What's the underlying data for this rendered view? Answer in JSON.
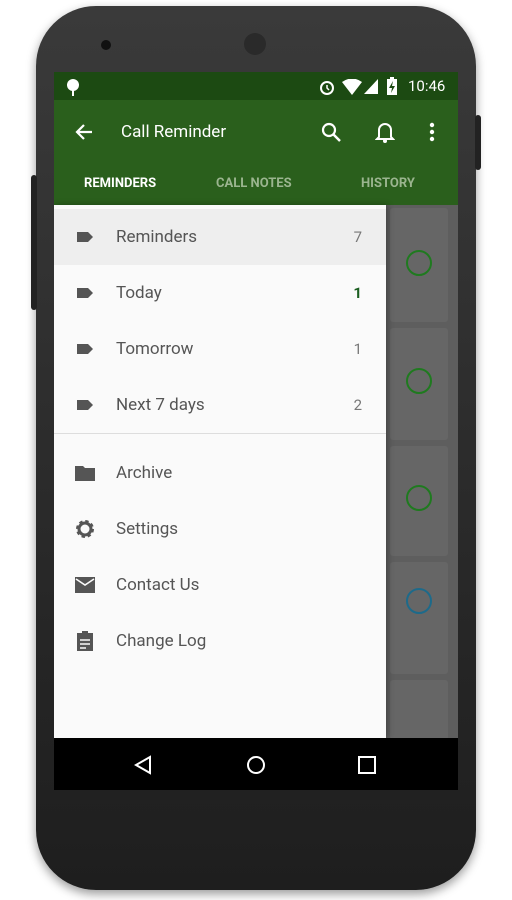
{
  "status": {
    "time": "10:46"
  },
  "toolbar": {
    "title": "Call Reminder"
  },
  "tabs": [
    {
      "label": "REMINDERS"
    },
    {
      "label": "CALL NOTES"
    },
    {
      "label": "HISTORY"
    }
  ],
  "drawer": {
    "items": [
      {
        "label": "Reminders",
        "count": "7",
        "icon": "label-icon"
      },
      {
        "label": "Today",
        "count": "1",
        "icon": "label-icon"
      },
      {
        "label": "Tomorrow",
        "count": "1",
        "icon": "label-icon"
      },
      {
        "label": "Next 7 days",
        "count": "2",
        "icon": "label-icon"
      }
    ],
    "secondary": [
      {
        "label": "Archive",
        "icon": "folder-icon"
      },
      {
        "label": "Settings",
        "icon": "gear-icon"
      },
      {
        "label": "Contact Us",
        "icon": "mail-icon"
      },
      {
        "label": "Change Log",
        "icon": "clipboard-icon"
      }
    ]
  },
  "colors": {
    "primary": "#2a5f1c",
    "accent": "#1f7a1f",
    "today_count": "#1b5e20"
  }
}
